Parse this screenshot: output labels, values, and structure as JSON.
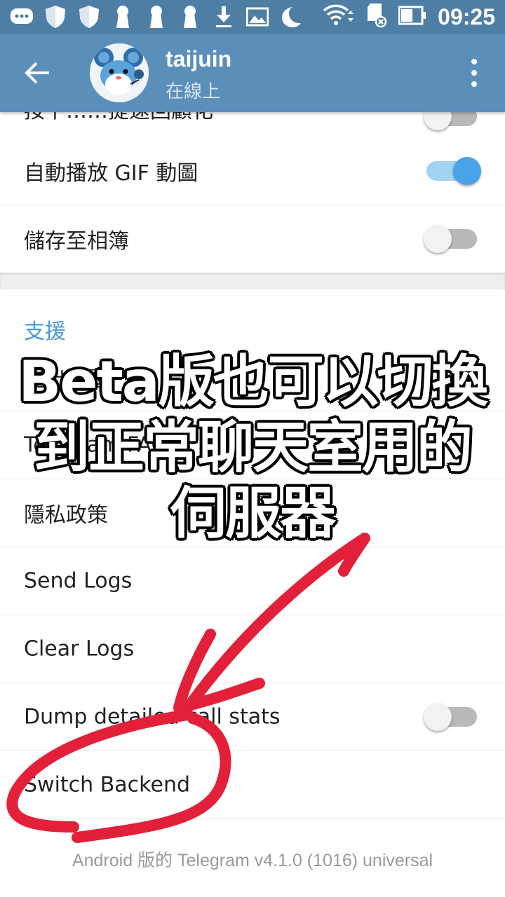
{
  "status_bar": {
    "time": "09:25",
    "icons": [
      "chat-icon",
      "shield-icon",
      "shield-icon",
      "keyhole-icon",
      "keyhole-icon",
      "keyhole-icon",
      "download-icon",
      "image-icon",
      "moon-icon",
      "wifi-icon",
      "sd-card-icon",
      "battery-icon"
    ]
  },
  "app_bar": {
    "title": "taijuin",
    "subtitle": "在線上"
  },
  "settings": {
    "partial_row": "按下……提速回顧化",
    "autoplay_gif": "自動播放 GIF 動圖",
    "save_to_gallery": "儲存至相簿",
    "support_header": "支援",
    "ask_question": "提出問題",
    "telegram_faq": "Telegram FAQ",
    "privacy_policy": "隱私政策",
    "send_logs": "Send Logs",
    "clear_logs": "Clear Logs",
    "dump_stats": "Dump detailed call stats",
    "switch_backend": "Switch Backend"
  },
  "toggles": {
    "autoplay_gif": true,
    "save_to_gallery": false,
    "dump_stats": false,
    "partial_row": false
  },
  "footer": "Android 版的 Telegram v4.1.0 (1016) universal",
  "overlay_caption": {
    "line1": "Beta版也可以切換",
    "line2": "到正常聊天室用的",
    "line3": "伺服器"
  },
  "colors": {
    "status_bar": "#4e7ea3",
    "app_bar": "#5b8fba",
    "accent": "#4a9ad6",
    "annotation": "#e3203a"
  }
}
